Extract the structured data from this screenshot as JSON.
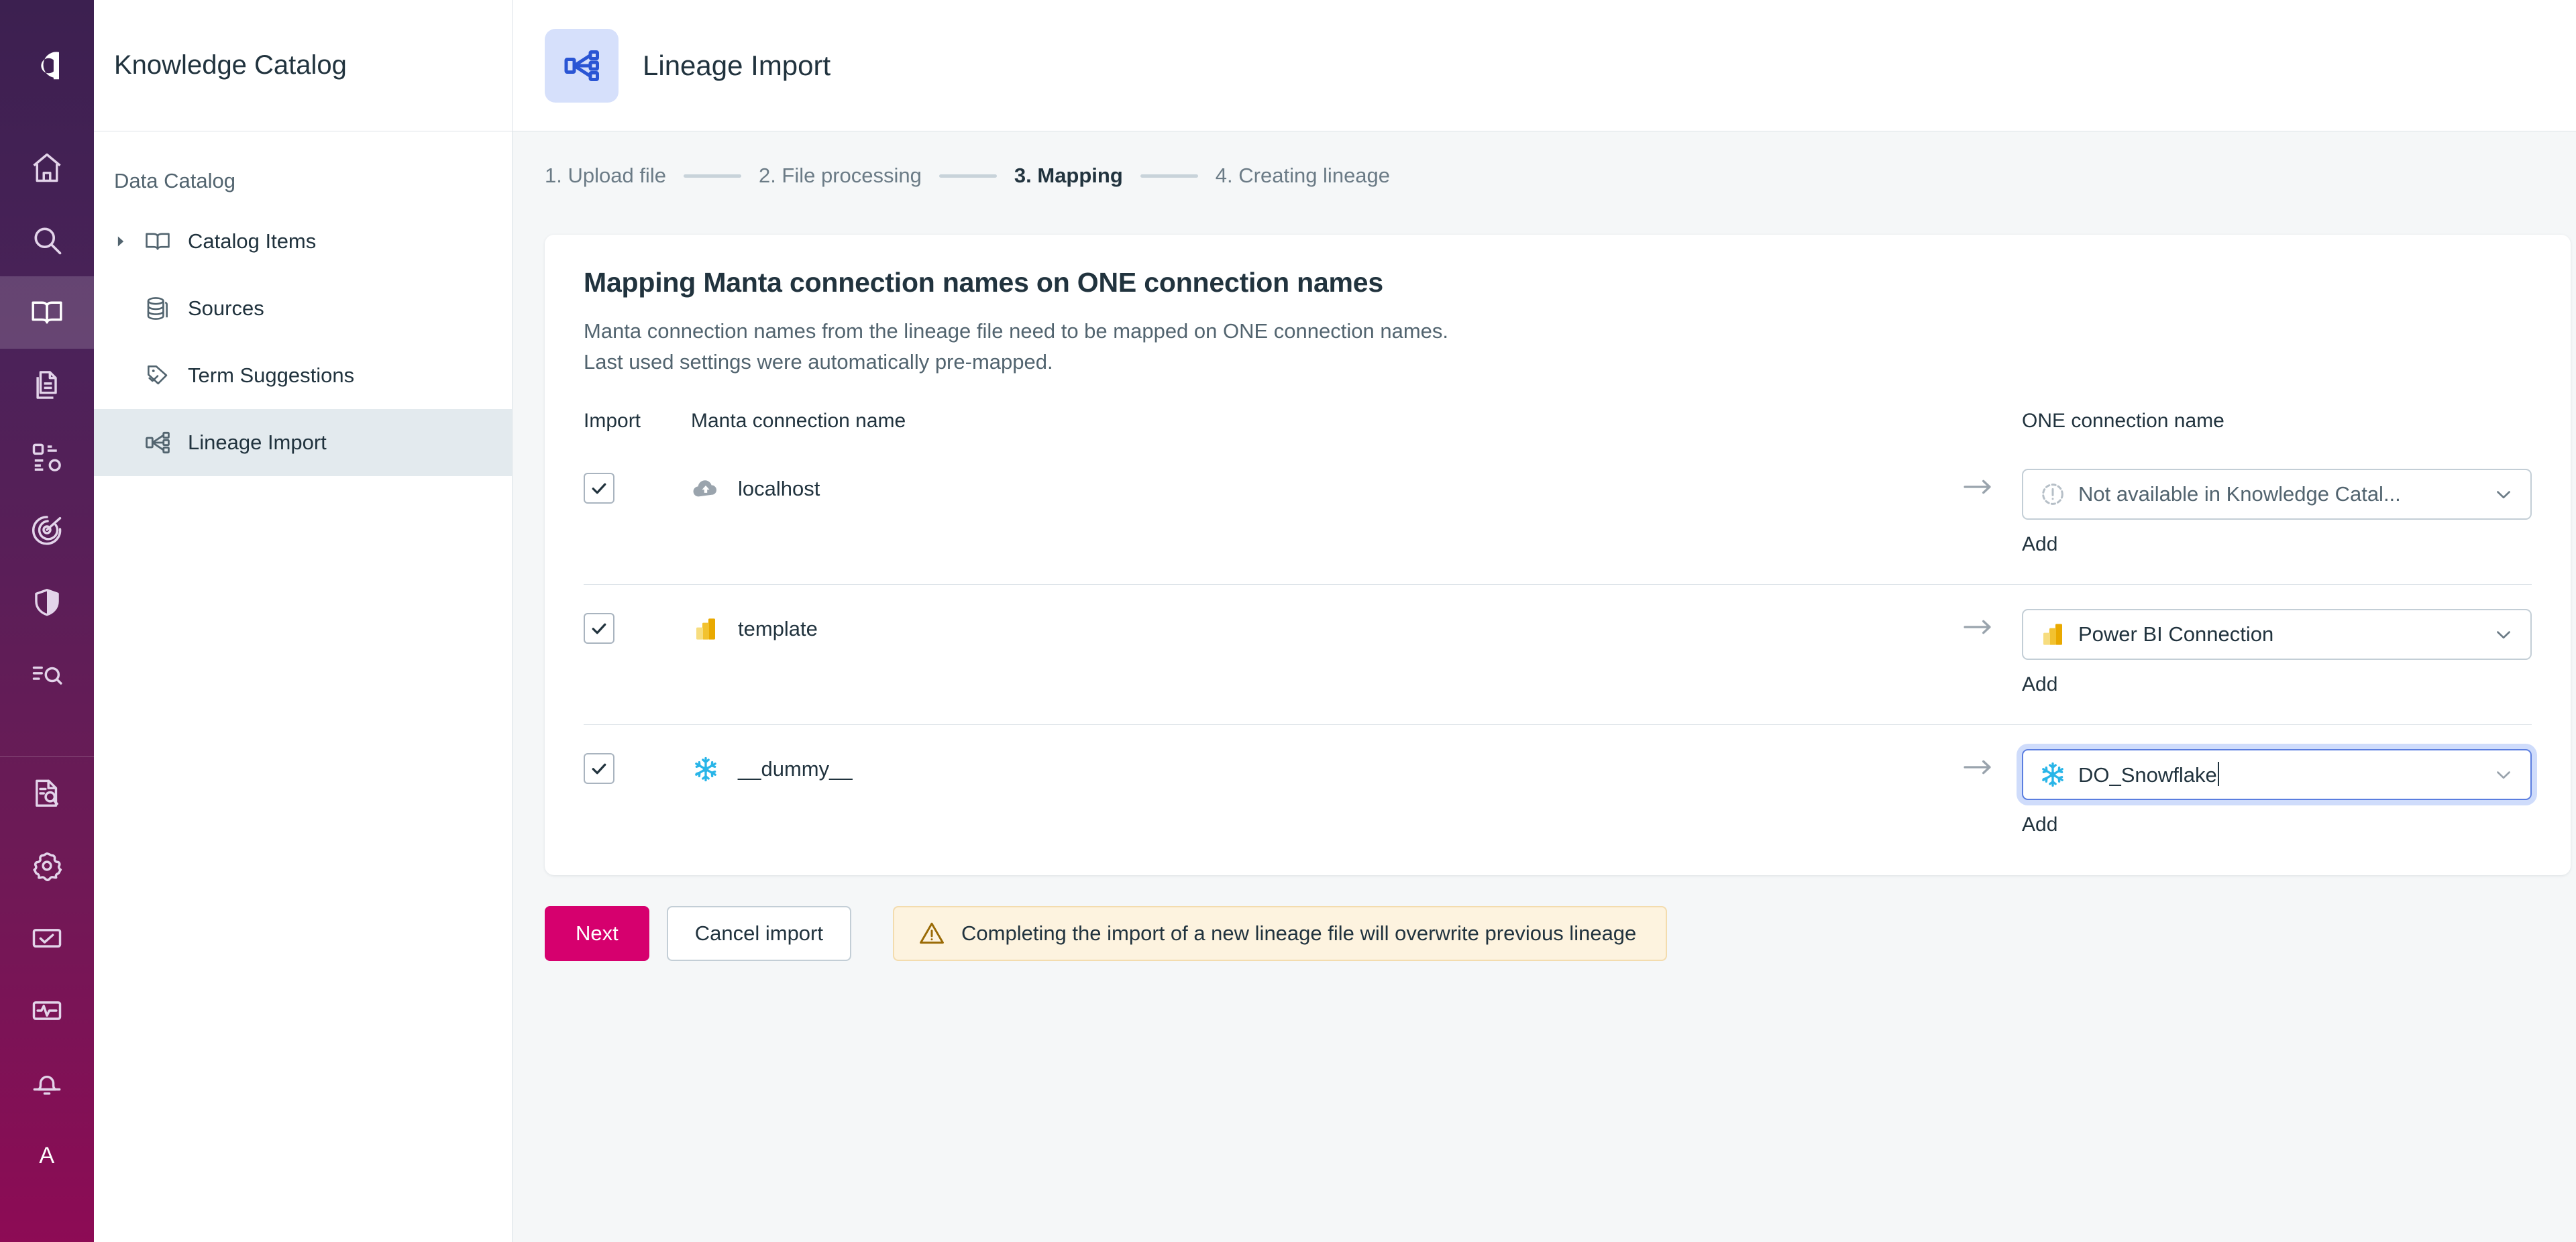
{
  "brand": {
    "logo_letter": "a",
    "accent_primary": "#d6006e",
    "accent_blue": "#2a55d4",
    "rail_gradient_top": "#3c2050",
    "rail_gradient_bottom": "#8d0b55"
  },
  "rail": {
    "items": [
      {
        "icon": "home-icon",
        "name": "rail-item-home"
      },
      {
        "icon": "search-icon",
        "name": "rail-item-search"
      },
      {
        "icon": "book-icon",
        "name": "rail-item-knowledge-catalog",
        "active": true
      },
      {
        "icon": "documents-icon",
        "name": "rail-item-documents"
      },
      {
        "icon": "model-icon",
        "name": "rail-item-data-model"
      },
      {
        "icon": "target-icon",
        "name": "rail-item-quality"
      },
      {
        "icon": "shield-icon",
        "name": "rail-item-governance"
      },
      {
        "icon": "rules-icon",
        "name": "rail-item-rules"
      }
    ],
    "bottom_items": [
      {
        "icon": "file-search-icon",
        "name": "rail-item-file-search"
      },
      {
        "icon": "gear-icon",
        "name": "rail-item-settings"
      },
      {
        "icon": "task-icon",
        "name": "rail-item-tasks"
      },
      {
        "icon": "monitor-icon",
        "name": "rail-item-monitoring"
      },
      {
        "icon": "bell-icon",
        "name": "rail-item-notifications"
      }
    ],
    "avatar_letter": "A"
  },
  "sidebar": {
    "title": "Knowledge Catalog",
    "section_label": "Data Catalog",
    "items": [
      {
        "label": "Catalog Items",
        "icon": "book-open-icon",
        "has_caret": true,
        "active": false
      },
      {
        "label": "Sources",
        "icon": "database-icon",
        "has_caret": false,
        "active": false
      },
      {
        "label": "Term Suggestions",
        "icon": "tag-check-icon",
        "has_caret": false,
        "active": false
      },
      {
        "label": "Lineage Import",
        "icon": "lineage-icon",
        "has_caret": false,
        "active": true
      }
    ]
  },
  "header": {
    "title": "Lineage Import",
    "icon": "lineage-icon"
  },
  "stepper": {
    "steps": [
      {
        "label": "1. Upload file",
        "current": false
      },
      {
        "label": "2. File processing",
        "current": false
      },
      {
        "label": "3. Mapping",
        "current": true
      },
      {
        "label": "4. Creating lineage",
        "current": false
      }
    ]
  },
  "card": {
    "title": "Mapping Manta connection names on ONE connection names",
    "description_line1": "Manta connection names from the lineage file need to be mapped on ONE connection names.",
    "description_line2": "Last used settings were automatically pre-mapped.",
    "columns": {
      "import": "Import",
      "manta": "Manta connection name",
      "one": "ONE connection name"
    },
    "rows": [
      {
        "checked": true,
        "manta_icon": "cloud-icon",
        "manta_name": "localhost",
        "one_value": "Not available in Knowledge Catal...",
        "one_icon": "not-available-icon",
        "one_muted": true,
        "focused": false,
        "add_label": "Add"
      },
      {
        "checked": true,
        "manta_icon": "powerbi-icon",
        "manta_name": "template",
        "one_value": "Power BI Connection",
        "one_icon": "powerbi-icon",
        "one_muted": false,
        "focused": false,
        "add_label": "Add"
      },
      {
        "checked": true,
        "manta_icon": "snowflake-icon",
        "manta_name": "__dummy__",
        "one_value": "DO_Snowflake",
        "one_icon": "snowflake-icon",
        "one_muted": false,
        "focused": true,
        "add_label": "Add"
      }
    ]
  },
  "actions": {
    "next_label": "Next",
    "cancel_label": "Cancel import",
    "warning_text": "Completing the import of a new lineage file will overwrite previous lineage",
    "warning_icon": "warning-triangle-icon"
  }
}
